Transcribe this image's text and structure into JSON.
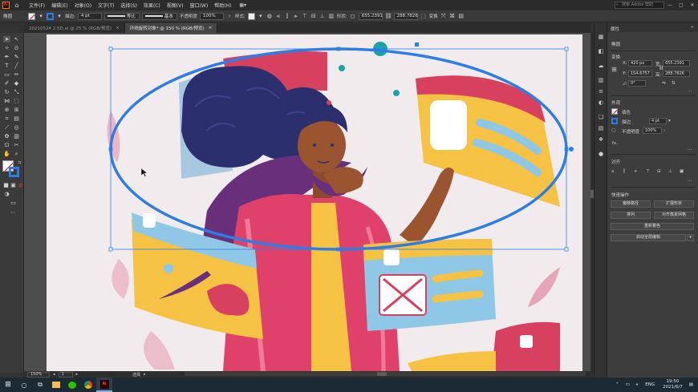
{
  "menubar": {
    "app_badge": "Ai",
    "items": [
      "文件(F)",
      "编辑(E)",
      "对象(O)",
      "文字(T)",
      "选择(S)",
      "效果(C)",
      "视图(V)",
      "窗口(W)",
      "帮助(H)"
    ],
    "search_placeholder": "搜索 Adobe 帮助"
  },
  "control_bar": {
    "object_label": "椭圆",
    "stroke_label": "描边:",
    "stroke_weight": "4 pt",
    "line_preset_1": "等比",
    "line_preset_2": "基本",
    "opacity_label": "不透明度",
    "opacity_value": "100%",
    "style_label": "样式:",
    "shape_label": "形状:",
    "width_value": "655.2391",
    "height_value": "288.7826",
    "transform_label": "变换"
  },
  "tabs": [
    {
      "label": "20210524 2.5D.ai @ 25 % (RGB/预览)",
      "close": "×",
      "active": false
    },
    {
      "label": "环绕旋转对象* @ 150 % (RGB/预览)",
      "close": "×",
      "active": true
    }
  ],
  "statusbar": {
    "zoom": "150%",
    "artboard_num": "1",
    "tool_name": "选择"
  },
  "properties": {
    "panel_title": "属性",
    "object_type": "椭圆",
    "transform_header": "变换",
    "x_label": "X:",
    "x_value": "420 px",
    "y_label": "Y:",
    "y_value": "154.6757",
    "w_label": "宽:",
    "w_value": "655.2391",
    "h_label": "高:",
    "h_value": "288.7826",
    "rotate_value": "0°",
    "appearance_header": "外观",
    "fill_label": "填色",
    "stroke_label": "描边",
    "stroke_value": "4 pt",
    "opacity_label": "不透明度",
    "opacity_value": "100%",
    "fx_label": "fx.",
    "align_header": "对齐",
    "quick_actions_header": "快速操作",
    "btn_offset_path": "偏移路径",
    "btn_expand_shape": "扩展形状",
    "btn_arrange": "排列",
    "btn_align_pixel": "对齐像素网格",
    "btn_recolor": "重新着色",
    "btn_global_edit": "启动全局编辑"
  },
  "taskbar": {
    "lang": "ENG",
    "time": "19:50",
    "date": "2021/6/7"
  },
  "colors": {
    "selection_blue": "#2c7ee6",
    "artboard_bg": "#f2ebee",
    "panel_bg": "#3d3d3d",
    "accent_pink": "#e0416a",
    "accent_yellow": "#f5c243",
    "accent_teal": "#1aa3a8"
  }
}
